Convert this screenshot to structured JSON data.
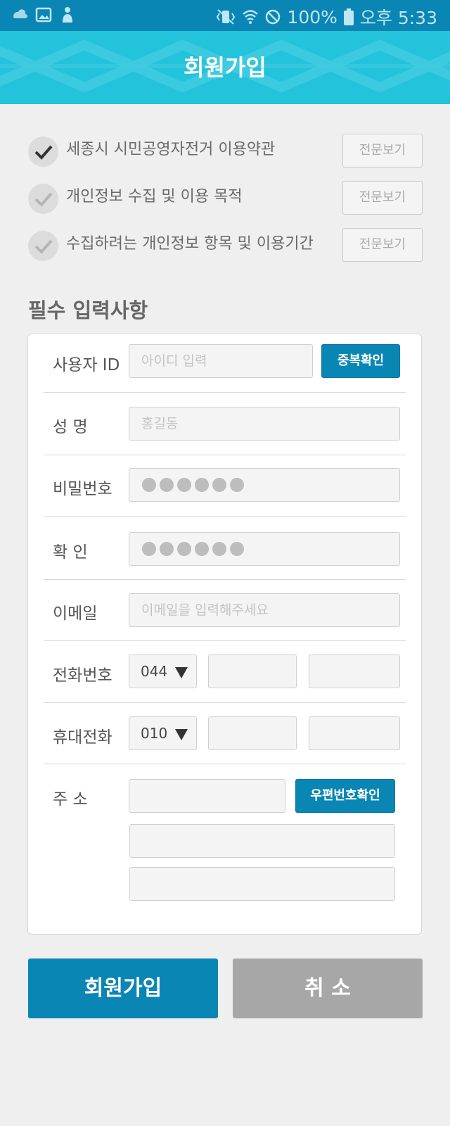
{
  "status_bar": {
    "battery": "100%",
    "time": "오후 5:33",
    "left_icons": [
      "cloud-icon",
      "image-icon",
      "person-icon"
    ],
    "right_icons": [
      "vibrate-icon",
      "wifi-icon",
      "no-disturb-icon",
      "battery-icon"
    ]
  },
  "header": {
    "title": "회원가입"
  },
  "terms": [
    {
      "label": "세종시 시민공영자전거 이용약관",
      "button": "전문보기",
      "checked": true
    },
    {
      "label": "개인정보 수집 및 이용 목적",
      "button": "전문보기",
      "checked": false
    },
    {
      "label": "수집하려는 개인정보 항목 및 이용기간",
      "button": "전문보기",
      "checked": false
    }
  ],
  "section_title": "필수 입력사항",
  "form": {
    "user_id": {
      "label": "사용자 ID",
      "placeholder": "아이디 입력",
      "button": "중복확인"
    },
    "name": {
      "label": "성 명",
      "placeholder": "홍길동"
    },
    "password": {
      "label": "비밀번호"
    },
    "confirm": {
      "label": "확 인"
    },
    "email": {
      "label": "이메일",
      "placeholder": "이메일을 입력해주세요"
    },
    "phone": {
      "label": "전화번호",
      "area_code": "044"
    },
    "mobile": {
      "label": "휴대전화",
      "prefix": "010"
    },
    "address": {
      "label": "주 소",
      "button": "우편번호확인"
    }
  },
  "actions": {
    "submit": "회원가입",
    "cancel": "취 소"
  },
  "colors": {
    "primary": "#0a86b5",
    "header": "#23c3dc",
    "status_bar": "#0a86b5",
    "cancel": "#a7a7a7"
  }
}
